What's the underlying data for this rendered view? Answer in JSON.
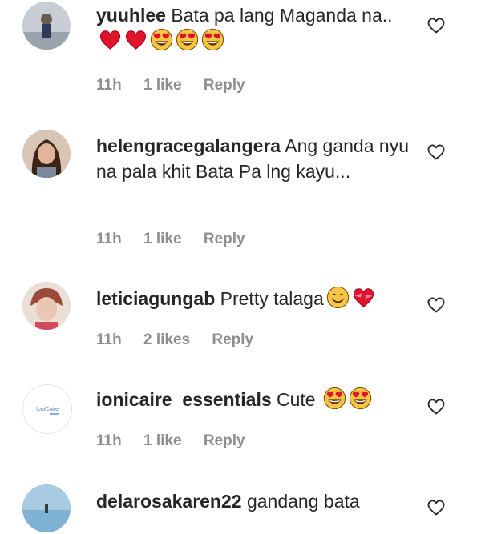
{
  "comments": [
    {
      "username": "yuuhlee",
      "text": "Bata pa lang Maganda na..",
      "emojis": [
        "red-heart",
        "red-heart",
        "heart-eyes",
        "heart-eyes",
        "heart-eyes"
      ],
      "time": "11h",
      "likes": "1 like",
      "reply": "Reply"
    },
    {
      "username": "helengracegalangera",
      "text": "Ang ganda nyu na pala khit Bata Pa lng kayu...",
      "emojis": [],
      "time": "11h",
      "likes": "1 like",
      "reply": "Reply"
    },
    {
      "username": "leticiagungab",
      "text": "Pretty talaga",
      "emojis": [
        "smiling-face",
        "heart-with-ribbon"
      ],
      "time": "11h",
      "likes": "2 likes",
      "reply": "Reply"
    },
    {
      "username": "ionicaire_essentials",
      "text": "Cute",
      "emojis": [
        "heart-eyes",
        "heart-eyes"
      ],
      "time": "11h",
      "likes": "1 like",
      "reply": "Reply",
      "avatar_text": "IoniCaire"
    },
    {
      "username": "delarosakaren22",
      "text": "gandang bata",
      "emojis": [],
      "time": "",
      "likes": "",
      "reply": ""
    }
  ],
  "colors": {
    "text": "#262626",
    "meta": "#8e8e8e",
    "heart_red": "#e0132d",
    "emoji_yellow": "#f7c544"
  }
}
